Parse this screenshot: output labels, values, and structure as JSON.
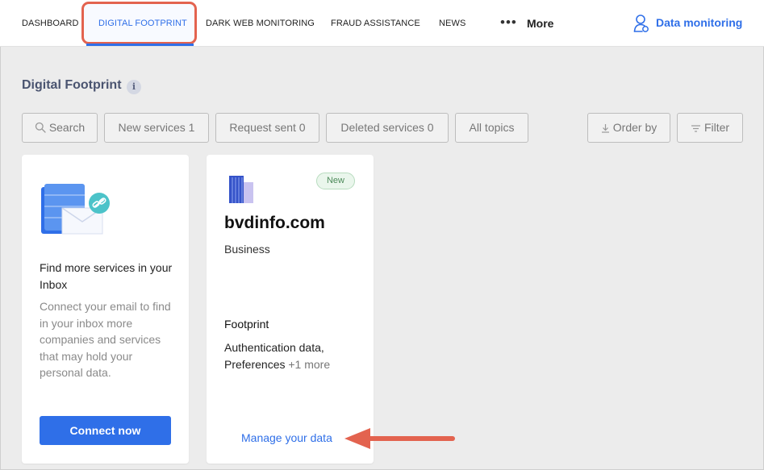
{
  "nav": {
    "items": [
      {
        "label": "DASHBOARD"
      },
      {
        "label": "DIGITAL FOOTPRINT"
      },
      {
        "label": "DARK WEB MONITORING"
      },
      {
        "label": "FRAUD ASSISTANCE"
      },
      {
        "label": "NEWS"
      }
    ],
    "active_index": 1,
    "more_icon": "ellipsis-icon",
    "more_label": "More",
    "account_icon": "user-icon",
    "account_label": "Data monitoring"
  },
  "page": {
    "title": "Digital Footprint",
    "info_icon": "i"
  },
  "filters": {
    "search_label": "Search",
    "new_services_label": "New services 1",
    "request_sent_label": "Request sent 0",
    "deleted_services_label": "Deleted services 0",
    "all_topics_label": "All topics",
    "order_by_label": "Order by",
    "filter_label": "Filter"
  },
  "inbox_card": {
    "illustration_icon": "email-link-icon",
    "title": "Find more services in your Inbox",
    "description": "Connect your email to find in your inbox more companies and services that may hold your personal data.",
    "button_label": "Connect now"
  },
  "service_card": {
    "logo_icon": "building-icon",
    "badge": "New",
    "name": "bvdinfo.com",
    "category": "Business",
    "footprint_title": "Footprint",
    "footprint_items": "Authentication data, Preferences",
    "footprint_more": "+1 more",
    "manage_link": "Manage your data"
  },
  "colors": {
    "accent": "#2f6fe8",
    "highlight": "#e3634f",
    "badge_green": "#4d8a5a"
  }
}
